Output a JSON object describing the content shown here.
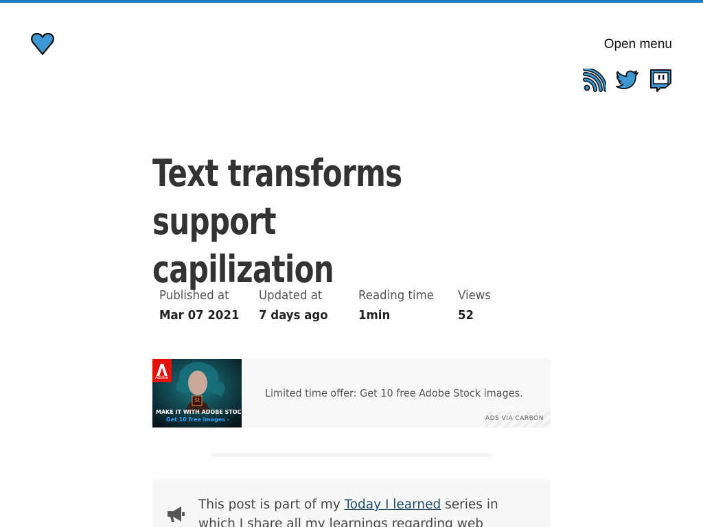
{
  "header": {
    "menu_label": "Open menu",
    "logo_icon": "heart-icon",
    "social": [
      {
        "icon": "rss-icon"
      },
      {
        "icon": "twitter-icon"
      },
      {
        "icon": "twitch-icon"
      }
    ],
    "accent_color": "#1a7ac4"
  },
  "article": {
    "title_line1": "Text transforms support",
    "title_line2": "capilization",
    "meta": [
      {
        "label": "Published at",
        "value": "Mar 07 2021"
      },
      {
        "label": "Updated at",
        "value": "7 days ago"
      },
      {
        "label": "Reading time",
        "value": "1min"
      },
      {
        "label": "Views",
        "value": "52"
      }
    ]
  },
  "ad": {
    "text": "Limited time offer: Get 10 free Adobe Stock images.",
    "via": "ADS VIA CARBON",
    "image_brand": "Adobe",
    "image_badge": "St",
    "image_headline": "MAKE IT WITH ADOBE STOCK.",
    "image_cta": "Get 10 free images ›"
  },
  "note": {
    "icon": "megaphone-icon",
    "text_before": "This post is part of my ",
    "link_text": "Today I learned",
    "text_after": " series in which I share all my learnings regarding web development."
  }
}
